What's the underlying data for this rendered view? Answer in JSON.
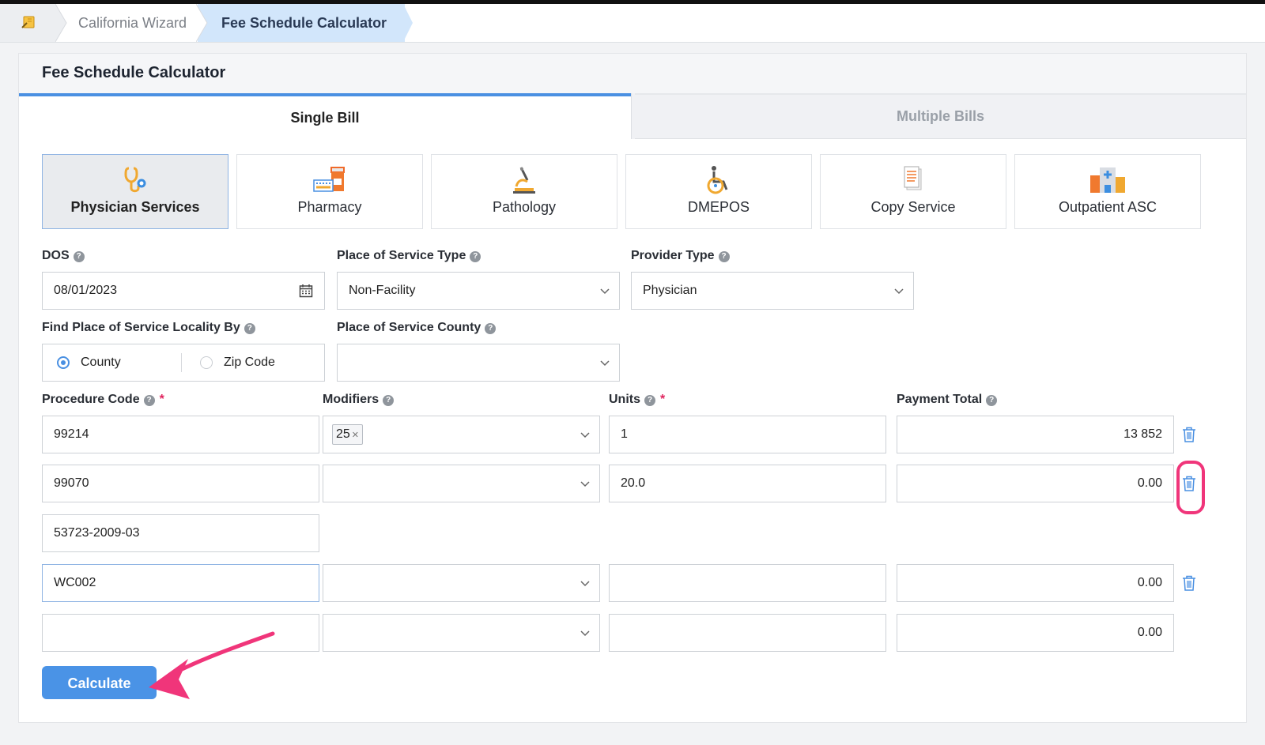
{
  "breadcrumb": {
    "items": [
      "California Wizard",
      "Fee Schedule Calculator"
    ]
  },
  "page": {
    "title": "Fee Schedule Calculator"
  },
  "tabs": [
    {
      "label": "Single Bill",
      "active": true
    },
    {
      "label": "Multiple Bills",
      "active": false
    }
  ],
  "services": [
    {
      "label": "Physician Services",
      "icon": "stethoscope-icon",
      "active": true
    },
    {
      "label": "Pharmacy",
      "icon": "pharmacy-icon",
      "active": false
    },
    {
      "label": "Pathology",
      "icon": "microscope-icon",
      "active": false
    },
    {
      "label": "DMEPOS",
      "icon": "wheelchair-icon",
      "active": false
    },
    {
      "label": "Copy Service",
      "icon": "document-icon",
      "active": false
    },
    {
      "label": "Outpatient ASC",
      "icon": "hospital-icon",
      "active": false
    }
  ],
  "fields": {
    "dos": {
      "label": "DOS",
      "value": "08/01/2023"
    },
    "place_of_service_type": {
      "label": "Place of Service Type",
      "value": "Non-Facility"
    },
    "provider_type": {
      "label": "Provider Type",
      "value": "Physician"
    },
    "locality_by": {
      "label": "Find Place of Service Locality By",
      "options": [
        "County",
        "Zip Code"
      ],
      "selected": "County"
    },
    "county": {
      "label": "Place of Service County",
      "value": ""
    }
  },
  "procedure_table": {
    "headers": {
      "procedure_code": "Procedure Code",
      "modifiers": "Modifiers",
      "units": "Units",
      "payment_total": "Payment Total",
      "required_mark": "*"
    },
    "rows": [
      {
        "procedure_code": "99214",
        "modifiers": [
          "25"
        ],
        "units": "1",
        "payment_total": "13 852"
      },
      {
        "procedure_code": "99070",
        "modifiers": [],
        "units": "20.0",
        "payment_total": "0.00"
      },
      {
        "procedure_code": "53723-2009-03"
      },
      {
        "procedure_code": "WC002",
        "modifiers": [],
        "units": "",
        "payment_total": "0.00"
      },
      {
        "procedure_code": "",
        "modifiers": [],
        "units": "",
        "payment_total": "0.00"
      }
    ]
  },
  "actions": {
    "calculate": "Calculate"
  },
  "colors": {
    "accent": "#4a90e2",
    "annotation": "#f0357a"
  }
}
